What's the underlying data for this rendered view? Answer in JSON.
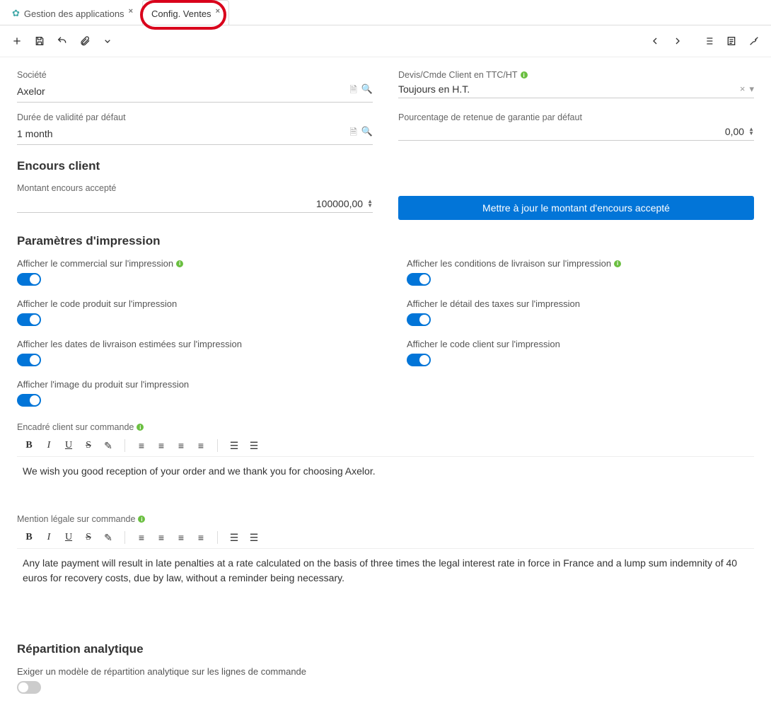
{
  "tabs": {
    "items": [
      {
        "label": "Gestion des applications"
      },
      {
        "label": "Config. Ventes"
      }
    ]
  },
  "fields": {
    "company_label": "Société",
    "company_value": "Axelor",
    "quote_mode_label": "Devis/Cmde Client en TTC/HT",
    "quote_mode_value": "Toujours en H.T.",
    "validity_label": "Durée de validité par défaut",
    "validity_value": "1 month",
    "retention_label": "Pourcentage de retenue de garantie par défaut",
    "retention_value": "0,00"
  },
  "sections": {
    "outstanding_title": "Encours client",
    "outstanding_amount_label": "Montant encours accepté",
    "outstanding_amount_value": "100000,00",
    "update_button": "Mettre à jour le montant d'encours accepté",
    "print_title": "Paramètres d'impression",
    "analytic_title": "Répartition analytique"
  },
  "toggles": {
    "salesman": "Afficher le commercial sur l'impression",
    "delivery_conditions": "Afficher les conditions de livraison sur l'impression",
    "product_code": "Afficher le code produit sur l'impression",
    "tax_detail": "Afficher le détail des taxes sur l'impression",
    "delivery_dates": "Afficher les dates de livraison estimées sur l'impression",
    "customer_code": "Afficher le code client sur l'impression",
    "product_image": "Afficher l'image du produit sur l'impression",
    "analytic_required": "Exiger un modèle de répartition analytique sur les lignes de commande"
  },
  "rte": {
    "client_box_label": "Encadré client sur commande",
    "client_box_text": "We wish you good reception of your order and we thank you for choosing Axelor.",
    "legal_label": "Mention légale sur commande",
    "legal_text": "Any late payment will result in late penalties at a rate calculated on the basis of three times the legal interest rate in force in France and a lump sum indemnity of 40 euros for recovery costs, due by law, without a reminder being necessary."
  }
}
